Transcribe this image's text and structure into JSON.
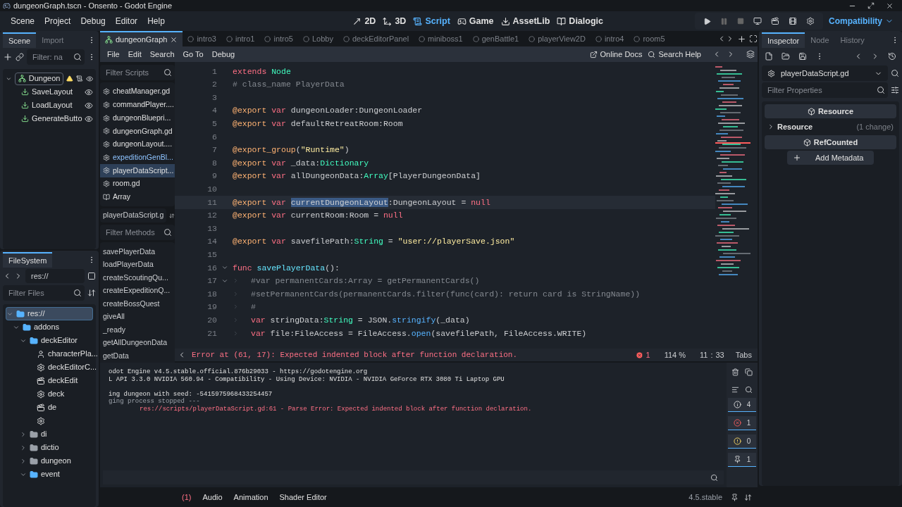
{
  "window": {
    "title": "dungeonGraph.tscn - Onsento - Godot Engine"
  },
  "menu": [
    "Scene",
    "Project",
    "Debug",
    "Editor",
    "Help"
  ],
  "workspaces": [
    {
      "label": "2D",
      "selected": false
    },
    {
      "label": "3D",
      "selected": false
    },
    {
      "label": "Script",
      "selected": true
    },
    {
      "label": "Game",
      "selected": false
    },
    {
      "label": "AssetLib",
      "selected": false
    },
    {
      "label": "Dialogic",
      "selected": false
    }
  ],
  "renderer": "Compatibility",
  "scene_dock": {
    "tabs": [
      {
        "label": "Scene",
        "selected": true
      },
      {
        "label": "Import",
        "selected": false
      }
    ],
    "filter": {
      "placeholder": "Filter: na"
    },
    "tree": [
      {
        "label": "Dungeon",
        "kind": "root",
        "warning": true,
        "children": [
          {
            "label": "SaveLayout",
            "kind": "button"
          },
          {
            "label": "LoadLayout",
            "kind": "button"
          },
          {
            "label": "GenerateButto",
            "kind": "button"
          }
        ]
      }
    ]
  },
  "filesystem": {
    "title": "FileSystem",
    "path": "res://",
    "filter": {
      "placeholder": "Filter Files"
    },
    "tree": [
      {
        "label": "res://",
        "kind": "folder",
        "selected": true,
        "expanded": true,
        "children": [
          {
            "label": "addons",
            "kind": "folder",
            "selected": false,
            "expanded": true,
            "children": [
              {
                "label": "deckEditor",
                "kind": "folder",
                "selected": false,
                "expanded": true,
                "children": [
                  {
                    "label": "characterPla...",
                    "kind": "character",
                    "selected": false
                  },
                  {
                    "label": "deckEditorC...",
                    "kind": "script",
                    "selected": false
                  },
                  {
                    "label": "deckEdit",
                    "kind": "scene",
                    "selected": false
                  },
                  {
                    "label": "deck",
                    "kind": "script",
                    "selected": false
                  },
                  {
                    "label": "de",
                    "kind": "scene",
                    "selected": false
                  },
                  {
                    "kind": "script",
                    "selected": false
                  }
                ]
              },
              {
                "label": "di",
                "kind": "folder",
                "selected": false,
                "expanded": false
              },
              {
                "label": "dictio",
                "kind": "folder",
                "selected": false,
                "expanded": false
              },
              {
                "label": "dungeon",
                "kind": "folder",
                "selected": false,
                "expanded": false
              },
              {
                "label": "event",
                "kind": "folder",
                "selected": false,
                "expanded": true
              }
            ]
          }
        ]
      }
    ]
  },
  "editor_tabs": [
    {
      "label": "dungeonGraph",
      "selected": true
    },
    {
      "label": "intro3",
      "selected": false
    },
    {
      "label": "intro1",
      "selected": false
    },
    {
      "label": "intro5",
      "selected": false
    },
    {
      "label": "Lobby",
      "selected": false
    },
    {
      "label": "deckEditorPanel",
      "selected": false
    },
    {
      "label": "miniboss1",
      "selected": false
    },
    {
      "label": "genBattle1",
      "selected": false
    },
    {
      "label": "playerView2D",
      "selected": false
    },
    {
      "label": "intro4",
      "selected": false
    },
    {
      "label": "room5",
      "selected": false
    }
  ],
  "script_menu": [
    "File",
    "Edit",
    "Search",
    "Go To",
    "Debug"
  ],
  "script_links": [
    "Online Docs",
    "Search Help"
  ],
  "scripts": {
    "filter": {
      "placeholder": "Filter Scripts"
    },
    "items": [
      {
        "label": "cheatManager.gd",
        "kind": "script",
        "selected": false,
        "accent": false
      },
      {
        "label": "commandPlayer....",
        "kind": "script",
        "selected": false,
        "accent": false
      },
      {
        "label": "dungeonBluepri...",
        "kind": "script",
        "selected": false,
        "accent": false
      },
      {
        "label": "dungeonGraph.gd",
        "kind": "script",
        "selected": false,
        "accent": false
      },
      {
        "label": "dungeonLayout....",
        "kind": "script",
        "selected": false,
        "accent": false
      },
      {
        "label": "expeditionGenBl...",
        "kind": "script",
        "selected": false,
        "accent": true
      },
      {
        "label": "playerDataScript...",
        "kind": "script",
        "selected": true,
        "accent": false
      },
      {
        "label": "room.gd",
        "kind": "script",
        "selected": false,
        "accent": false
      },
      {
        "label": "Array",
        "kind": "doc",
        "selected": false,
        "accent": false
      }
    ],
    "current": "playerDataScript.g",
    "methods_filter": {
      "placeholder": "Filter Methods"
    },
    "methods": [
      "savePlayerData",
      "loadPlayerData",
      "createScoutingQu...",
      "createExpeditionQ...",
      "createBossQuest",
      "giveAll",
      "_ready",
      "getAllDungeonData",
      "getData"
    ]
  },
  "code": [
    {
      "number": "1",
      "current": false,
      "fold": false,
      "tab": false,
      "tokens": [
        {
          "text": "extends",
          "kind": "keyword"
        },
        {
          "text": " Node",
          "kind": "type"
        }
      ]
    },
    {
      "number": "2",
      "current": false,
      "fold": false,
      "tab": false,
      "tokens": [
        {
          "text": "# class_name PlayerData",
          "kind": "comment"
        }
      ]
    },
    {
      "number": "3",
      "current": false,
      "fold": false,
      "tab": false
    },
    {
      "number": "4",
      "current": false,
      "fold": false,
      "tab": false,
      "tokens": [
        {
          "text": "@export",
          "kind": "annotation"
        },
        {
          "text": " var",
          "kind": "keyword"
        },
        {
          "text": " dungeonLoader:DungeonLoader",
          "kind": "plain"
        }
      ]
    },
    {
      "number": "5",
      "current": false,
      "fold": false,
      "tab": false,
      "tokens": [
        {
          "text": "@export",
          "kind": "annotation"
        },
        {
          "text": " var",
          "kind": "keyword"
        },
        {
          "text": " defaultRetreatRoom:Room",
          "kind": "plain"
        }
      ]
    },
    {
      "number": "6",
      "current": false,
      "fold": false,
      "tab": false
    },
    {
      "number": "7",
      "current": false,
      "fold": false,
      "tab": false,
      "tokens": [
        {
          "text": "@export_group",
          "kind": "annotation"
        },
        {
          "text": "(",
          "kind": "plain"
        },
        {
          "text": "\"Runtime\"",
          "kind": "string"
        },
        {
          "text": ")",
          "kind": "plain"
        }
      ]
    },
    {
      "number": "8",
      "current": false,
      "fold": false,
      "tab": false,
      "tokens": [
        {
          "text": "@export",
          "kind": "annotation"
        },
        {
          "text": " var",
          "kind": "keyword"
        },
        {
          "text": " _data:",
          "kind": "plain"
        },
        {
          "text": "Dictionary",
          "kind": "type"
        }
      ]
    },
    {
      "number": "9",
      "current": false,
      "fold": false,
      "tab": false,
      "tokens": [
        {
          "text": "@export",
          "kind": "annotation"
        },
        {
          "text": " var",
          "kind": "keyword"
        },
        {
          "text": " allDungeonData:",
          "kind": "plain"
        },
        {
          "text": "Array",
          "kind": "type"
        },
        {
          "text": "[PlayerDungeonData]",
          "kind": "plain"
        }
      ]
    },
    {
      "number": "10",
      "current": false,
      "fold": false,
      "tab": false
    },
    {
      "number": "11",
      "current": true,
      "fold": false,
      "tab": false,
      "tokens": [
        {
          "text": "@export",
          "kind": "annotation"
        },
        {
          "text": " var ",
          "kind": "keyword"
        },
        {
          "text": "currentDungeonLayout",
          "kind": "selection"
        },
        {
          "text": ":DungeonLayout = ",
          "kind": "plain"
        },
        {
          "text": "null",
          "kind": "keyword"
        }
      ]
    },
    {
      "number": "12",
      "current": false,
      "fold": false,
      "tab": false,
      "tokens": [
        {
          "text": "@export",
          "kind": "annotation"
        },
        {
          "text": " var",
          "kind": "keyword"
        },
        {
          "text": " currentRoom:Room = ",
          "kind": "plain"
        },
        {
          "text": "null",
          "kind": "keyword"
        }
      ]
    },
    {
      "number": "13",
      "current": false,
      "fold": false,
      "tab": false
    },
    {
      "number": "14",
      "current": false,
      "fold": false,
      "tab": false,
      "tokens": [
        {
          "text": "@export",
          "kind": "annotation"
        },
        {
          "text": " var",
          "kind": "keyword"
        },
        {
          "text": " savefilePath:",
          "kind": "plain"
        },
        {
          "text": "String",
          "kind": "type"
        },
        {
          "text": " = ",
          "kind": "plain"
        },
        {
          "text": "\"user://playerSave.json\"",
          "kind": "string"
        }
      ]
    },
    {
      "number": "15",
      "current": false,
      "fold": false,
      "tab": false
    },
    {
      "number": "16",
      "current": false,
      "fold": true,
      "tab": false,
      "tokens": [
        {
          "text": "func",
          "kind": "keyword"
        },
        {
          "text": " savePlayerData",
          "kind": "function"
        },
        {
          "text": "():",
          "kind": "plain"
        }
      ]
    },
    {
      "number": "17",
      "current": false,
      "fold": true,
      "tab": true,
      "tokens": [
        {
          "text": "#var permanentCards:Array = getPermanentCards()",
          "kind": "comment"
        }
      ]
    },
    {
      "number": "18",
      "current": false,
      "fold": false,
      "tab": true,
      "tokens": [
        {
          "text": "#setPermanentCards(permanentCards.filter(func(card): return card is StringName))",
          "kind": "comment"
        }
      ]
    },
    {
      "number": "19",
      "current": false,
      "fold": false,
      "tab": true,
      "tokens": [
        {
          "text": "#",
          "kind": "comment"
        }
      ]
    },
    {
      "number": "20",
      "current": false,
      "fold": false,
      "tab": true,
      "tokens": [
        {
          "text": "var",
          "kind": "keyword"
        },
        {
          "text": " stringData:",
          "kind": "plain"
        },
        {
          "text": "String",
          "kind": "type"
        },
        {
          "text": " = JSON.",
          "kind": "plain"
        },
        {
          "text": "stringify",
          "kind": "call"
        },
        {
          "text": "(_data)",
          "kind": "plain"
        }
      ]
    },
    {
      "number": "21",
      "current": false,
      "fold": false,
      "tab": true,
      "tokens": [
        {
          "text": "var",
          "kind": "keyword"
        },
        {
          "text": " file:FileAccess = FileAccess.",
          "kind": "plain"
        },
        {
          "text": "open",
          "kind": "call"
        },
        {
          "text": "(savefilePath, FileAccess.WRITE)",
          "kind": "plain"
        }
      ]
    }
  ],
  "status": {
    "message": "Error at (61, 17): Expected indented block after function declaration.",
    "errors": "1",
    "zoom": "114 %",
    "line": "11",
    "sep": ":",
    "column": "33",
    "indent": "Tabs"
  },
  "console": {
    "lines": [
      {
        "text": "odot Engine v4.5.stable.official.876b29033 - https://godotengine.org",
        "kind": "plain"
      },
      {
        "text": "L API 3.3.0 NVIDIA 560.94 - Compatibility - Using Device: NVIDIA - NVIDIA GeForce RTX 3080 Ti Laptop GPU",
        "kind": "plain"
      },
      {
        "kind": "blank"
      },
      {
        "text": "ing dungeon with seed: -5415975968433254457",
        "kind": "plain"
      },
      {
        "text": "ging process stopped ---",
        "kind": "muted"
      },
      {
        "text": "res://scripts/playerDataScript.gd:61 - Parse Error: Expected indented block after function declaration.",
        "kind": "error"
      }
    ],
    "filters": [
      {
        "kind": "all",
        "count": "4"
      },
      {
        "kind": "error",
        "count": "1"
      },
      {
        "kind": "warning",
        "count": "0"
      },
      {
        "kind": "editor",
        "count": "1"
      }
    ]
  },
  "bottom_tabs": [
    "(1)",
    "Audio",
    "Animation",
    "Shader Editor"
  ],
  "version": "4.5.stable",
  "inspector": {
    "tabs": [
      {
        "label": "Inspector",
        "selected": true
      },
      {
        "label": "Node",
        "selected": false
      },
      {
        "label": "History",
        "selected": false
      }
    ],
    "resource": "playerDataScript.gd",
    "filter": {
      "placeholder": "Filter Properties"
    },
    "sections": [
      {
        "kind": "header",
        "label": "Resource"
      },
      {
        "kind": "group",
        "label": "Resource",
        "note": "(1 change)"
      },
      {
        "kind": "header",
        "label": "RefCounted"
      },
      {
        "kind": "action",
        "label": "Add Metadata"
      }
    ]
  }
}
